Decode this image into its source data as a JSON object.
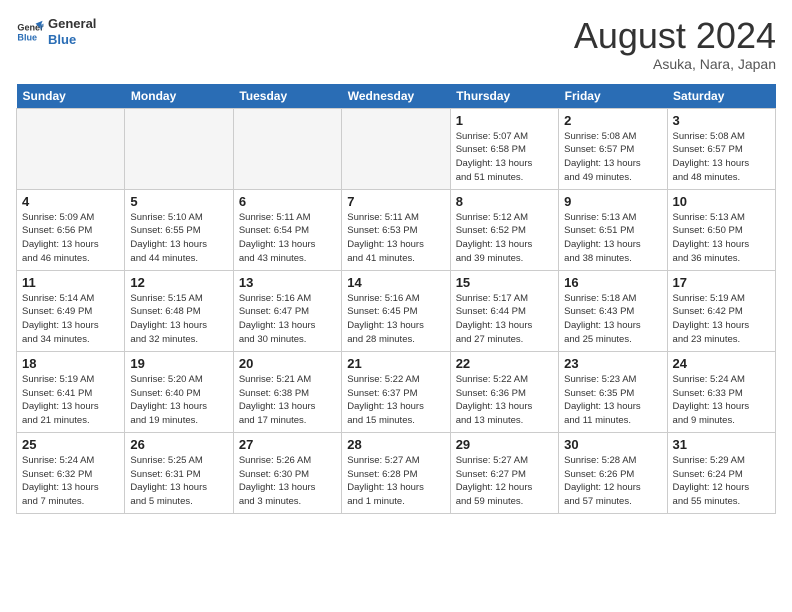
{
  "header": {
    "logo_line1": "General",
    "logo_line2": "Blue",
    "month_year": "August 2024",
    "location": "Asuka, Nara, Japan"
  },
  "weekdays": [
    "Sunday",
    "Monday",
    "Tuesday",
    "Wednesday",
    "Thursday",
    "Friday",
    "Saturday"
  ],
  "weeks": [
    [
      {
        "day": "",
        "info": ""
      },
      {
        "day": "",
        "info": ""
      },
      {
        "day": "",
        "info": ""
      },
      {
        "day": "",
        "info": ""
      },
      {
        "day": "1",
        "info": "Sunrise: 5:07 AM\nSunset: 6:58 PM\nDaylight: 13 hours\nand 51 minutes."
      },
      {
        "day": "2",
        "info": "Sunrise: 5:08 AM\nSunset: 6:57 PM\nDaylight: 13 hours\nand 49 minutes."
      },
      {
        "day": "3",
        "info": "Sunrise: 5:08 AM\nSunset: 6:57 PM\nDaylight: 13 hours\nand 48 minutes."
      }
    ],
    [
      {
        "day": "4",
        "info": "Sunrise: 5:09 AM\nSunset: 6:56 PM\nDaylight: 13 hours\nand 46 minutes."
      },
      {
        "day": "5",
        "info": "Sunrise: 5:10 AM\nSunset: 6:55 PM\nDaylight: 13 hours\nand 44 minutes."
      },
      {
        "day": "6",
        "info": "Sunrise: 5:11 AM\nSunset: 6:54 PM\nDaylight: 13 hours\nand 43 minutes."
      },
      {
        "day": "7",
        "info": "Sunrise: 5:11 AM\nSunset: 6:53 PM\nDaylight: 13 hours\nand 41 minutes."
      },
      {
        "day": "8",
        "info": "Sunrise: 5:12 AM\nSunset: 6:52 PM\nDaylight: 13 hours\nand 39 minutes."
      },
      {
        "day": "9",
        "info": "Sunrise: 5:13 AM\nSunset: 6:51 PM\nDaylight: 13 hours\nand 38 minutes."
      },
      {
        "day": "10",
        "info": "Sunrise: 5:13 AM\nSunset: 6:50 PM\nDaylight: 13 hours\nand 36 minutes."
      }
    ],
    [
      {
        "day": "11",
        "info": "Sunrise: 5:14 AM\nSunset: 6:49 PM\nDaylight: 13 hours\nand 34 minutes."
      },
      {
        "day": "12",
        "info": "Sunrise: 5:15 AM\nSunset: 6:48 PM\nDaylight: 13 hours\nand 32 minutes."
      },
      {
        "day": "13",
        "info": "Sunrise: 5:16 AM\nSunset: 6:47 PM\nDaylight: 13 hours\nand 30 minutes."
      },
      {
        "day": "14",
        "info": "Sunrise: 5:16 AM\nSunset: 6:45 PM\nDaylight: 13 hours\nand 28 minutes."
      },
      {
        "day": "15",
        "info": "Sunrise: 5:17 AM\nSunset: 6:44 PM\nDaylight: 13 hours\nand 27 minutes."
      },
      {
        "day": "16",
        "info": "Sunrise: 5:18 AM\nSunset: 6:43 PM\nDaylight: 13 hours\nand 25 minutes."
      },
      {
        "day": "17",
        "info": "Sunrise: 5:19 AM\nSunset: 6:42 PM\nDaylight: 13 hours\nand 23 minutes."
      }
    ],
    [
      {
        "day": "18",
        "info": "Sunrise: 5:19 AM\nSunset: 6:41 PM\nDaylight: 13 hours\nand 21 minutes."
      },
      {
        "day": "19",
        "info": "Sunrise: 5:20 AM\nSunset: 6:40 PM\nDaylight: 13 hours\nand 19 minutes."
      },
      {
        "day": "20",
        "info": "Sunrise: 5:21 AM\nSunset: 6:38 PM\nDaylight: 13 hours\nand 17 minutes."
      },
      {
        "day": "21",
        "info": "Sunrise: 5:22 AM\nSunset: 6:37 PM\nDaylight: 13 hours\nand 15 minutes."
      },
      {
        "day": "22",
        "info": "Sunrise: 5:22 AM\nSunset: 6:36 PM\nDaylight: 13 hours\nand 13 minutes."
      },
      {
        "day": "23",
        "info": "Sunrise: 5:23 AM\nSunset: 6:35 PM\nDaylight: 13 hours\nand 11 minutes."
      },
      {
        "day": "24",
        "info": "Sunrise: 5:24 AM\nSunset: 6:33 PM\nDaylight: 13 hours\nand 9 minutes."
      }
    ],
    [
      {
        "day": "25",
        "info": "Sunrise: 5:24 AM\nSunset: 6:32 PM\nDaylight: 13 hours\nand 7 minutes."
      },
      {
        "day": "26",
        "info": "Sunrise: 5:25 AM\nSunset: 6:31 PM\nDaylight: 13 hours\nand 5 minutes."
      },
      {
        "day": "27",
        "info": "Sunrise: 5:26 AM\nSunset: 6:30 PM\nDaylight: 13 hours\nand 3 minutes."
      },
      {
        "day": "28",
        "info": "Sunrise: 5:27 AM\nSunset: 6:28 PM\nDaylight: 13 hours\nand 1 minute."
      },
      {
        "day": "29",
        "info": "Sunrise: 5:27 AM\nSunset: 6:27 PM\nDaylight: 12 hours\nand 59 minutes."
      },
      {
        "day": "30",
        "info": "Sunrise: 5:28 AM\nSunset: 6:26 PM\nDaylight: 12 hours\nand 57 minutes."
      },
      {
        "day": "31",
        "info": "Sunrise: 5:29 AM\nSunset: 6:24 PM\nDaylight: 12 hours\nand 55 minutes."
      }
    ]
  ]
}
